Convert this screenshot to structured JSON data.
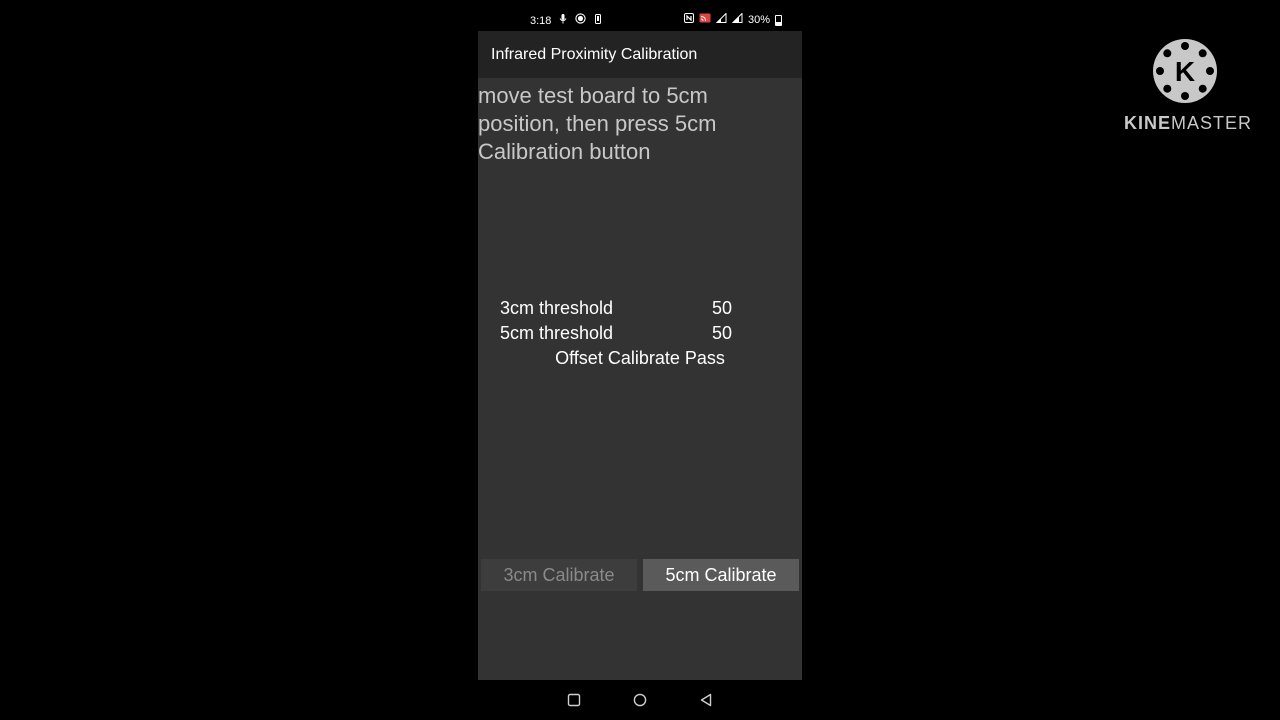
{
  "status_bar": {
    "time": "3:18",
    "battery": "30%",
    "icons_left": [
      "mic-icon",
      "record-icon",
      "phone-vibrate-icon"
    ],
    "icons_right": [
      "nfc-icon",
      "cast-icon",
      "signal-1-icon",
      "signal-2-icon",
      "battery-icon"
    ]
  },
  "app_bar": {
    "title": "Infrared Proximity Calibration"
  },
  "main": {
    "instruction": "move test board to 5cm position, then press 5cm Calibration button",
    "thresholds": [
      {
        "label": "3cm threshold",
        "value": "50"
      },
      {
        "label": "5cm threshold",
        "value": "50"
      }
    ],
    "result": "Offset Calibrate Pass",
    "buttons": {
      "calibrate_3cm": "3cm Calibrate",
      "calibrate_5cm": "5cm Calibrate"
    }
  },
  "watermark": {
    "logo_letter": "K",
    "brand_part1": "KINE",
    "brand_part2": "MASTER"
  },
  "colors": {
    "background": "#000000",
    "screen": "#333333",
    "app_bar": "#232323",
    "button_disabled": "#3d3d3d",
    "button_enabled": "#5a5a5a"
  }
}
